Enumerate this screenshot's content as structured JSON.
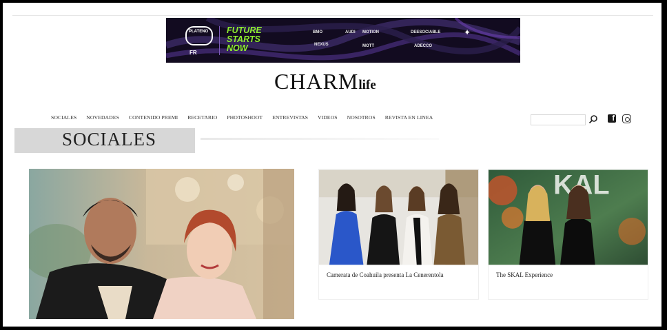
{
  "banner": {
    "platform_label": "PLATENO",
    "platform_sub": "FR",
    "tagline": [
      "FUTURE",
      "STARTS",
      "NOW"
    ],
    "sponsors": [
      "BMO",
      "AUDI",
      "MOTION",
      "DEESOCIABLE",
      "NEXUS",
      "ADECCO",
      "MOTT"
    ]
  },
  "brand": {
    "main": "CHARM",
    "suffix": "life"
  },
  "nav": {
    "items": [
      "SOCIALES",
      "NOVEDADES",
      "CONTENIDO PREMI",
      "RECETARIO",
      "PHOTOSHOOT",
      "ENTREVISTAS",
      "VIDEOS",
      "NOSOTROS",
      "REVISTA EN LINEA"
    ],
    "search_placeholder": ""
  },
  "section": {
    "title": "SOCIALES"
  },
  "cards": [
    {
      "caption": "Camerata de Coahuila presenta La Cenerentola"
    },
    {
      "caption": "The SKAL Experience"
    }
  ],
  "colors": {
    "accent_green": "#8ff02f",
    "banner_bg": "#120b20",
    "section_bar": "#d7d7d7"
  }
}
